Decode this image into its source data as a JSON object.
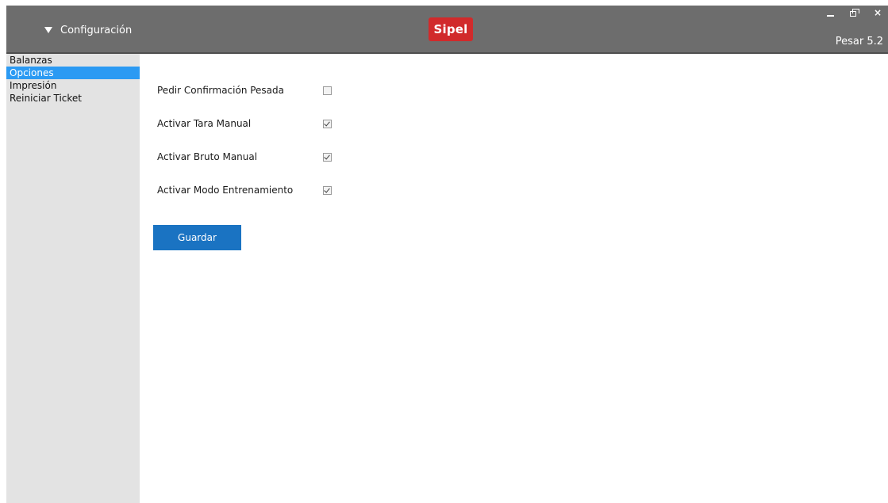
{
  "titlebar": {
    "menu_label": "Configuración",
    "logo_text": "Sipel",
    "version": "Pesar 5.2",
    "controls": {
      "minimize": "minimize-icon",
      "restore": "restore-icon",
      "close": "close-icon",
      "close_glyph": "×"
    },
    "colors": {
      "bar": "#6d6d6d",
      "logo": "#d12a2b"
    }
  },
  "sidebar": {
    "items": [
      {
        "label": "Balanzas",
        "active": false
      },
      {
        "label": "Opciones",
        "active": true
      },
      {
        "label": "Impresión",
        "active": false
      },
      {
        "label": "Reiniciar Ticket",
        "active": false
      }
    ],
    "colors": {
      "bg": "#e3e3e3",
      "active": "#2b9af3"
    }
  },
  "options": [
    {
      "label": "Pedir Confirmación Pesada",
      "checked": false
    },
    {
      "label": "Activar Tara Manual",
      "checked": true
    },
    {
      "label": "Activar Bruto Manual",
      "checked": true
    },
    {
      "label": "Activar Modo Entrenamiento",
      "checked": true
    }
  ],
  "save_button": {
    "label": "Guardar",
    "color": "#1a73c2"
  }
}
